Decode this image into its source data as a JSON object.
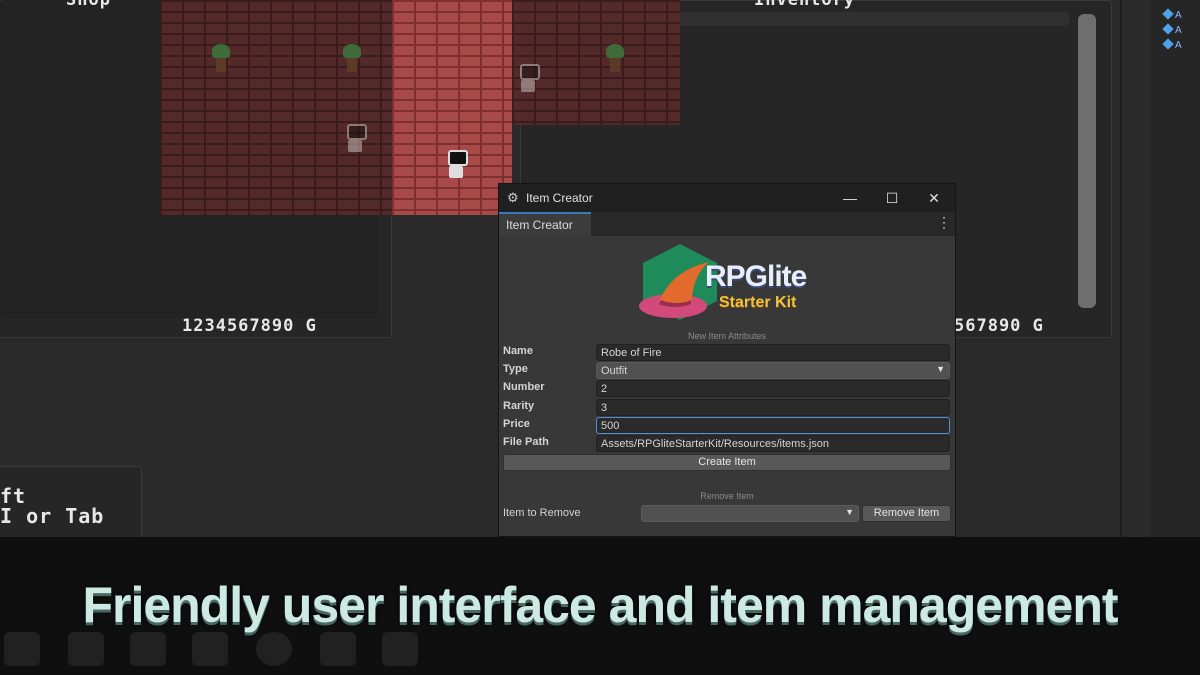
{
  "game": {
    "shop_title": "Shop",
    "inventory_title": "Inventory",
    "shop_gold": "1234567890 G",
    "inventory_gold": "567890 G",
    "help_line1": "ft",
    "help_line2": "I or Tab"
  },
  "hierarchy": {
    "rows": [
      "A",
      "A",
      "A"
    ]
  },
  "window": {
    "title": "Item Creator",
    "tab_label": "Item Creator",
    "minimize": "—",
    "maximize": "☐",
    "close": "✕",
    "menu": "⋮"
  },
  "logo": {
    "title": "RPGlite",
    "subtitle": "Starter Kit"
  },
  "form": {
    "section_title": "New Item Attributes",
    "name_label": "Name",
    "name_value": "Robe of Fire",
    "type_label": "Type",
    "type_value": "Outfit",
    "number_label": "Number",
    "number_value": "2",
    "rarity_label": "Rarity",
    "rarity_value": "3",
    "price_label": "Price",
    "price_value": "500",
    "filepath_label": "File Path",
    "filepath_value": "Assets/RPGliteStarterKit/Resources/items.json",
    "create_button": "Create Item"
  },
  "remove": {
    "section_title": "Remove Item",
    "label": "Item to Remove",
    "selected_value": "",
    "button": "Remove Item"
  },
  "headline": "Friendly user interface and item management",
  "colors": {
    "accent": "#3a79bb",
    "focus_border": "#4d90d3",
    "brick": "#a84a4a",
    "headline": "#cdeae2"
  }
}
